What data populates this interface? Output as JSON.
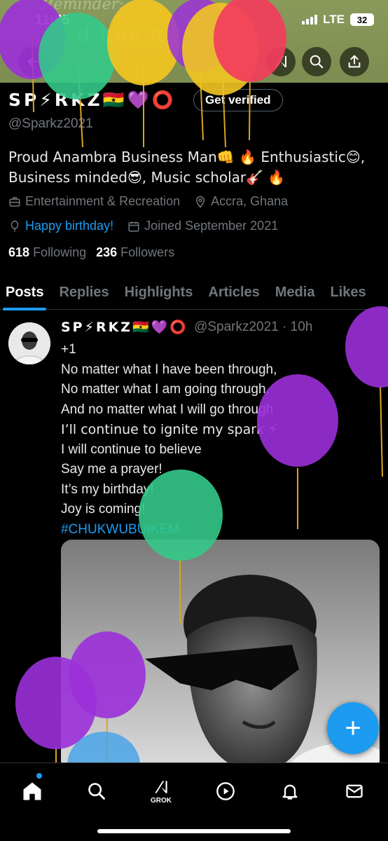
{
  "status_bar": {
    "time": "11:45",
    "network": "LTE",
    "battery": "32"
  },
  "banner": {
    "text_line1": "Reminder:",
    "text_line2": "d has a"
  },
  "profile": {
    "display_name": "SP⚡RKZ🇬🇭💜⭕",
    "get_verified_label": "Get verified",
    "handle": "@Sparkz2021",
    "bio_line1": "Proud Anambra Business Man👊 🔥 Enthusiastic😊,",
    "bio_line2": "Business minded😎, Music scholar🎸 🔥",
    "category": "Entertainment & Recreation",
    "location": "Accra, Ghana",
    "birthday": "Happy birthday!",
    "joined": "Joined September 2021",
    "following_count": "618",
    "following_label": "Following",
    "followers_count": "236",
    "followers_label": "Followers"
  },
  "tabs": [
    "Posts",
    "Replies",
    "Highlights",
    "Articles",
    "Media",
    "Likes"
  ],
  "post": {
    "name": "SP⚡RKZ🇬🇭💜⭕",
    "handle_time": "@Sparkz2021 · 10h",
    "lines": [
      "+1",
      "No matter what I have been through,",
      "No matter what I am going through,",
      "And no matter what I will go through",
      "I’ll continue to ignite my spark ⚡",
      "I will continue to believe",
      "Say me a prayer!",
      "It’s my birthday!",
      "Joy is coming!"
    ],
    "hashtag": "#CHUKWUBUIKEM"
  },
  "fab_label": "+",
  "nav": {
    "grok_label": "GROK"
  },
  "icons": [
    "back-arrow-icon",
    "grok-icon",
    "search-icon",
    "share-icon",
    "briefcase-icon",
    "location-pin-icon",
    "balloon-icon",
    "calendar-icon",
    "home-icon",
    "play-icon",
    "bell-icon",
    "mail-icon"
  ],
  "colors": {
    "accent": "#1d9bf0",
    "muted": "#71767b",
    "background": "#000000",
    "banner": "#8a9a5b"
  }
}
